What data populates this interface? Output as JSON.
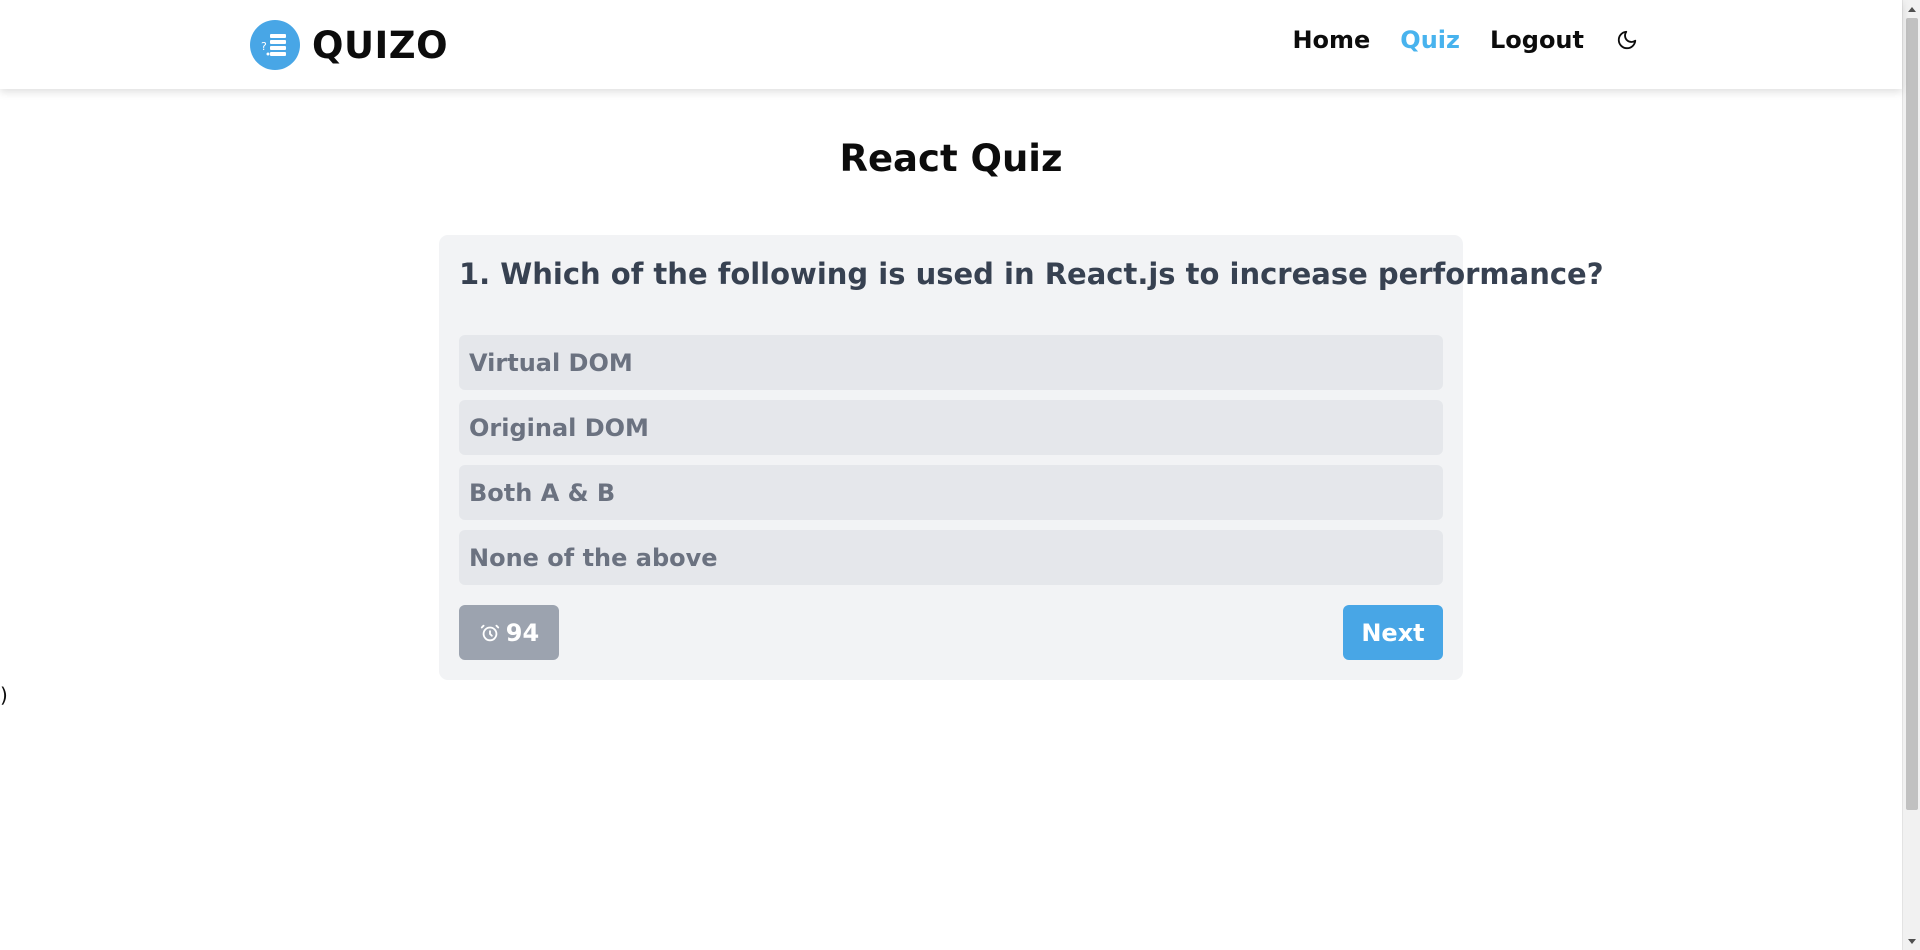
{
  "brand": {
    "name": "QUIZO",
    "logo_icon": "quiz-list-icon"
  },
  "nav": {
    "items": [
      {
        "label": "Home",
        "active": false
      },
      {
        "label": "Quiz",
        "active": true
      },
      {
        "label": "Logout",
        "active": false
      }
    ],
    "theme_icon": "moon-icon"
  },
  "page": {
    "title": "React Quiz"
  },
  "quiz": {
    "question": "1. Which of the following is used in React.js to increase performance?",
    "options": [
      "Virtual DOM",
      "Original DOM",
      "Both A & B",
      "None of the above"
    ],
    "timer": {
      "icon": "alarm-clock-icon",
      "value": "94"
    },
    "next_label": "Next"
  },
  "stray_text": ")",
  "colors": {
    "accent": "#48a6e6",
    "active_nav": "#48b3ee",
    "card_bg": "#f2f3f5",
    "option_bg": "#e5e7eb",
    "option_text": "#6b7280",
    "timer_bg": "#9ca3af",
    "question_text": "#374151"
  }
}
